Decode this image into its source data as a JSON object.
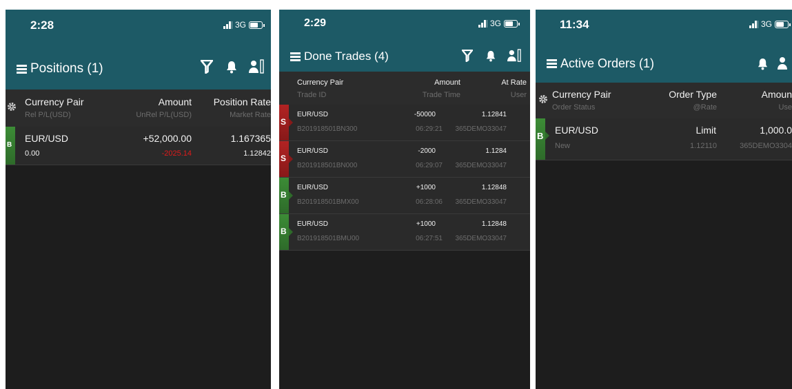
{
  "screens": [
    {
      "time": "2:28",
      "network": "3G",
      "title": "Positions (1)",
      "header": {
        "col1": "Currency Pair",
        "col1_sub": "Rel P/L(USD)",
        "col2": "Amount",
        "col2_sub": "UnRel P/L(USD)",
        "col3": "Position Rate",
        "col3_sub": "Market Rate"
      },
      "rows": [
        {
          "side": "B",
          "pair": "EUR/USD",
          "amount": "+52,000.00",
          "rate": "1.167365",
          "rel": "0.00",
          "unrel": "-2025.14",
          "market": "1.12842"
        }
      ]
    },
    {
      "time": "2:29",
      "network": "3G",
      "title": "Done Trades (4)",
      "header": {
        "col1": "Currency Pair",
        "col1_sub": "Trade ID",
        "col2": "Amount",
        "col2_sub": "Trade Time",
        "col3": "At Rate",
        "col3_sub": "User"
      },
      "rows": [
        {
          "side": "S",
          "pair": "EUR/USD",
          "id": "B201918501BN300",
          "amount": "-50000",
          "time": "06:29:21",
          "rate": "1.12841",
          "user": "365DEMO33047"
        },
        {
          "side": "S",
          "pair": "EUR/USD",
          "id": "B201918501BN000",
          "amount": "-2000",
          "time": "06:29:07",
          "rate": "1.1284",
          "user": "365DEMO33047"
        },
        {
          "side": "B",
          "pair": "EUR/USD",
          "id": "B201918501BMX00",
          "amount": "+1000",
          "time": "06:28:06",
          "rate": "1.12848",
          "user": "365DEMO33047"
        },
        {
          "side": "B",
          "pair": "EUR/USD",
          "id": "B201918501BMU00",
          "amount": "+1000",
          "time": "06:27:51",
          "rate": "1.12848",
          "user": "365DEMO33047"
        }
      ]
    },
    {
      "time": "11:34",
      "network": "3G",
      "title": "Active Orders (1)",
      "header": {
        "col1": "Currency Pair",
        "col1_sub": "Order Status",
        "col2": "Order Type",
        "col2_sub": "@Rate",
        "col3": "Amoun",
        "col3_sub": "Use"
      },
      "rows": [
        {
          "side": "B",
          "pair": "EUR/USD",
          "type": "Limit",
          "amount": "1,000.0",
          "status": "New",
          "rate": "1.12110",
          "user": "365DEMO3304"
        }
      ]
    }
  ],
  "icons": {
    "menu": "hamburger-icon",
    "filter": "filter-icon",
    "bell": "bell-icon",
    "user": "user-icon",
    "settings": "gear-icon",
    "battery": "battery-icon",
    "signal": "signal-icon"
  },
  "colors": {
    "teal": "#1d5a66",
    "buy": "#2e6b2a",
    "sell": "#871919",
    "negative": "#e01b1b"
  }
}
